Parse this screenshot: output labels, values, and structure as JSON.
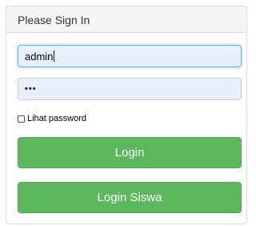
{
  "panel": {
    "heading": "Please Sign In"
  },
  "form": {
    "username_value": "admin",
    "password_mask": "•••",
    "show_password_label": "Lihat password",
    "show_password_checked": false
  },
  "buttons": {
    "login_label": "Login",
    "login_siswa_label": "Login Siswa"
  },
  "colors": {
    "button_green": "#5cb85c",
    "autofill_bg": "#e8f0fe",
    "focus_border": "#66afe9"
  }
}
